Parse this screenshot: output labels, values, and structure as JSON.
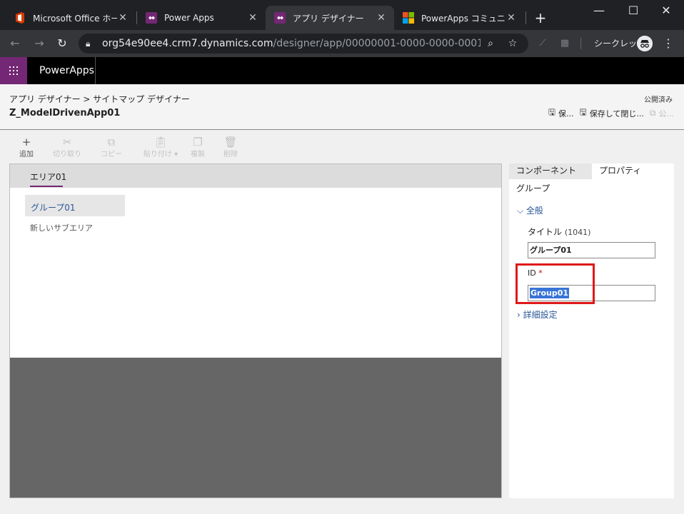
{
  "browser": {
    "tabs": [
      {
        "title": "Microsoft Office ホーム",
        "icon": "office-icon"
      },
      {
        "title": "Power Apps",
        "icon": "powerapps-icon"
      },
      {
        "title": "アプリ デザイナー",
        "icon": "powerapps-icon"
      },
      {
        "title": "PowerApps コミュニティ",
        "icon": "microsoft-icon"
      }
    ],
    "url_host": "org54e90ee4.crm7.dynamics.com",
    "url_path": "/designer/app/00000001-0000-0000-0001-00000...",
    "incognito_label": "シークレット",
    "colors": {
      "frame": "#202124",
      "toolbar": "#35363a"
    }
  },
  "app": {
    "brand": "PowerApps",
    "waffle_color": "#742774"
  },
  "header": {
    "breadcrumb_parent": "アプリ デザイナー",
    "breadcrumb_separator": ">",
    "breadcrumb_current": "サイトマップ デザイナー",
    "app_title": "Z_ModelDrivenApp01",
    "publish_state": "公開済み",
    "save_label": "保...",
    "save_close_label": "保存して閉じ...",
    "publish_label": "公..."
  },
  "commands": {
    "add": "追加",
    "cut": "切り取り",
    "copy": "コピー",
    "paste": "貼り付け",
    "duplicate": "複製",
    "delete": "削除"
  },
  "canvas": {
    "area_label": "エリア01",
    "group_label": "グループ01",
    "subarea_label": "新しいサブエリア"
  },
  "panel": {
    "tab_components": "コンポーネント",
    "tab_properties": "プロパティ",
    "section": "グループ",
    "general": "全般",
    "title_label": "タイトル",
    "title_count": "(1041)",
    "title_value": "グループ01",
    "id_label": "ID",
    "id_required": "*",
    "id_value": "Group01",
    "advanced": "詳細設定",
    "highlight_color": "#e01818"
  }
}
